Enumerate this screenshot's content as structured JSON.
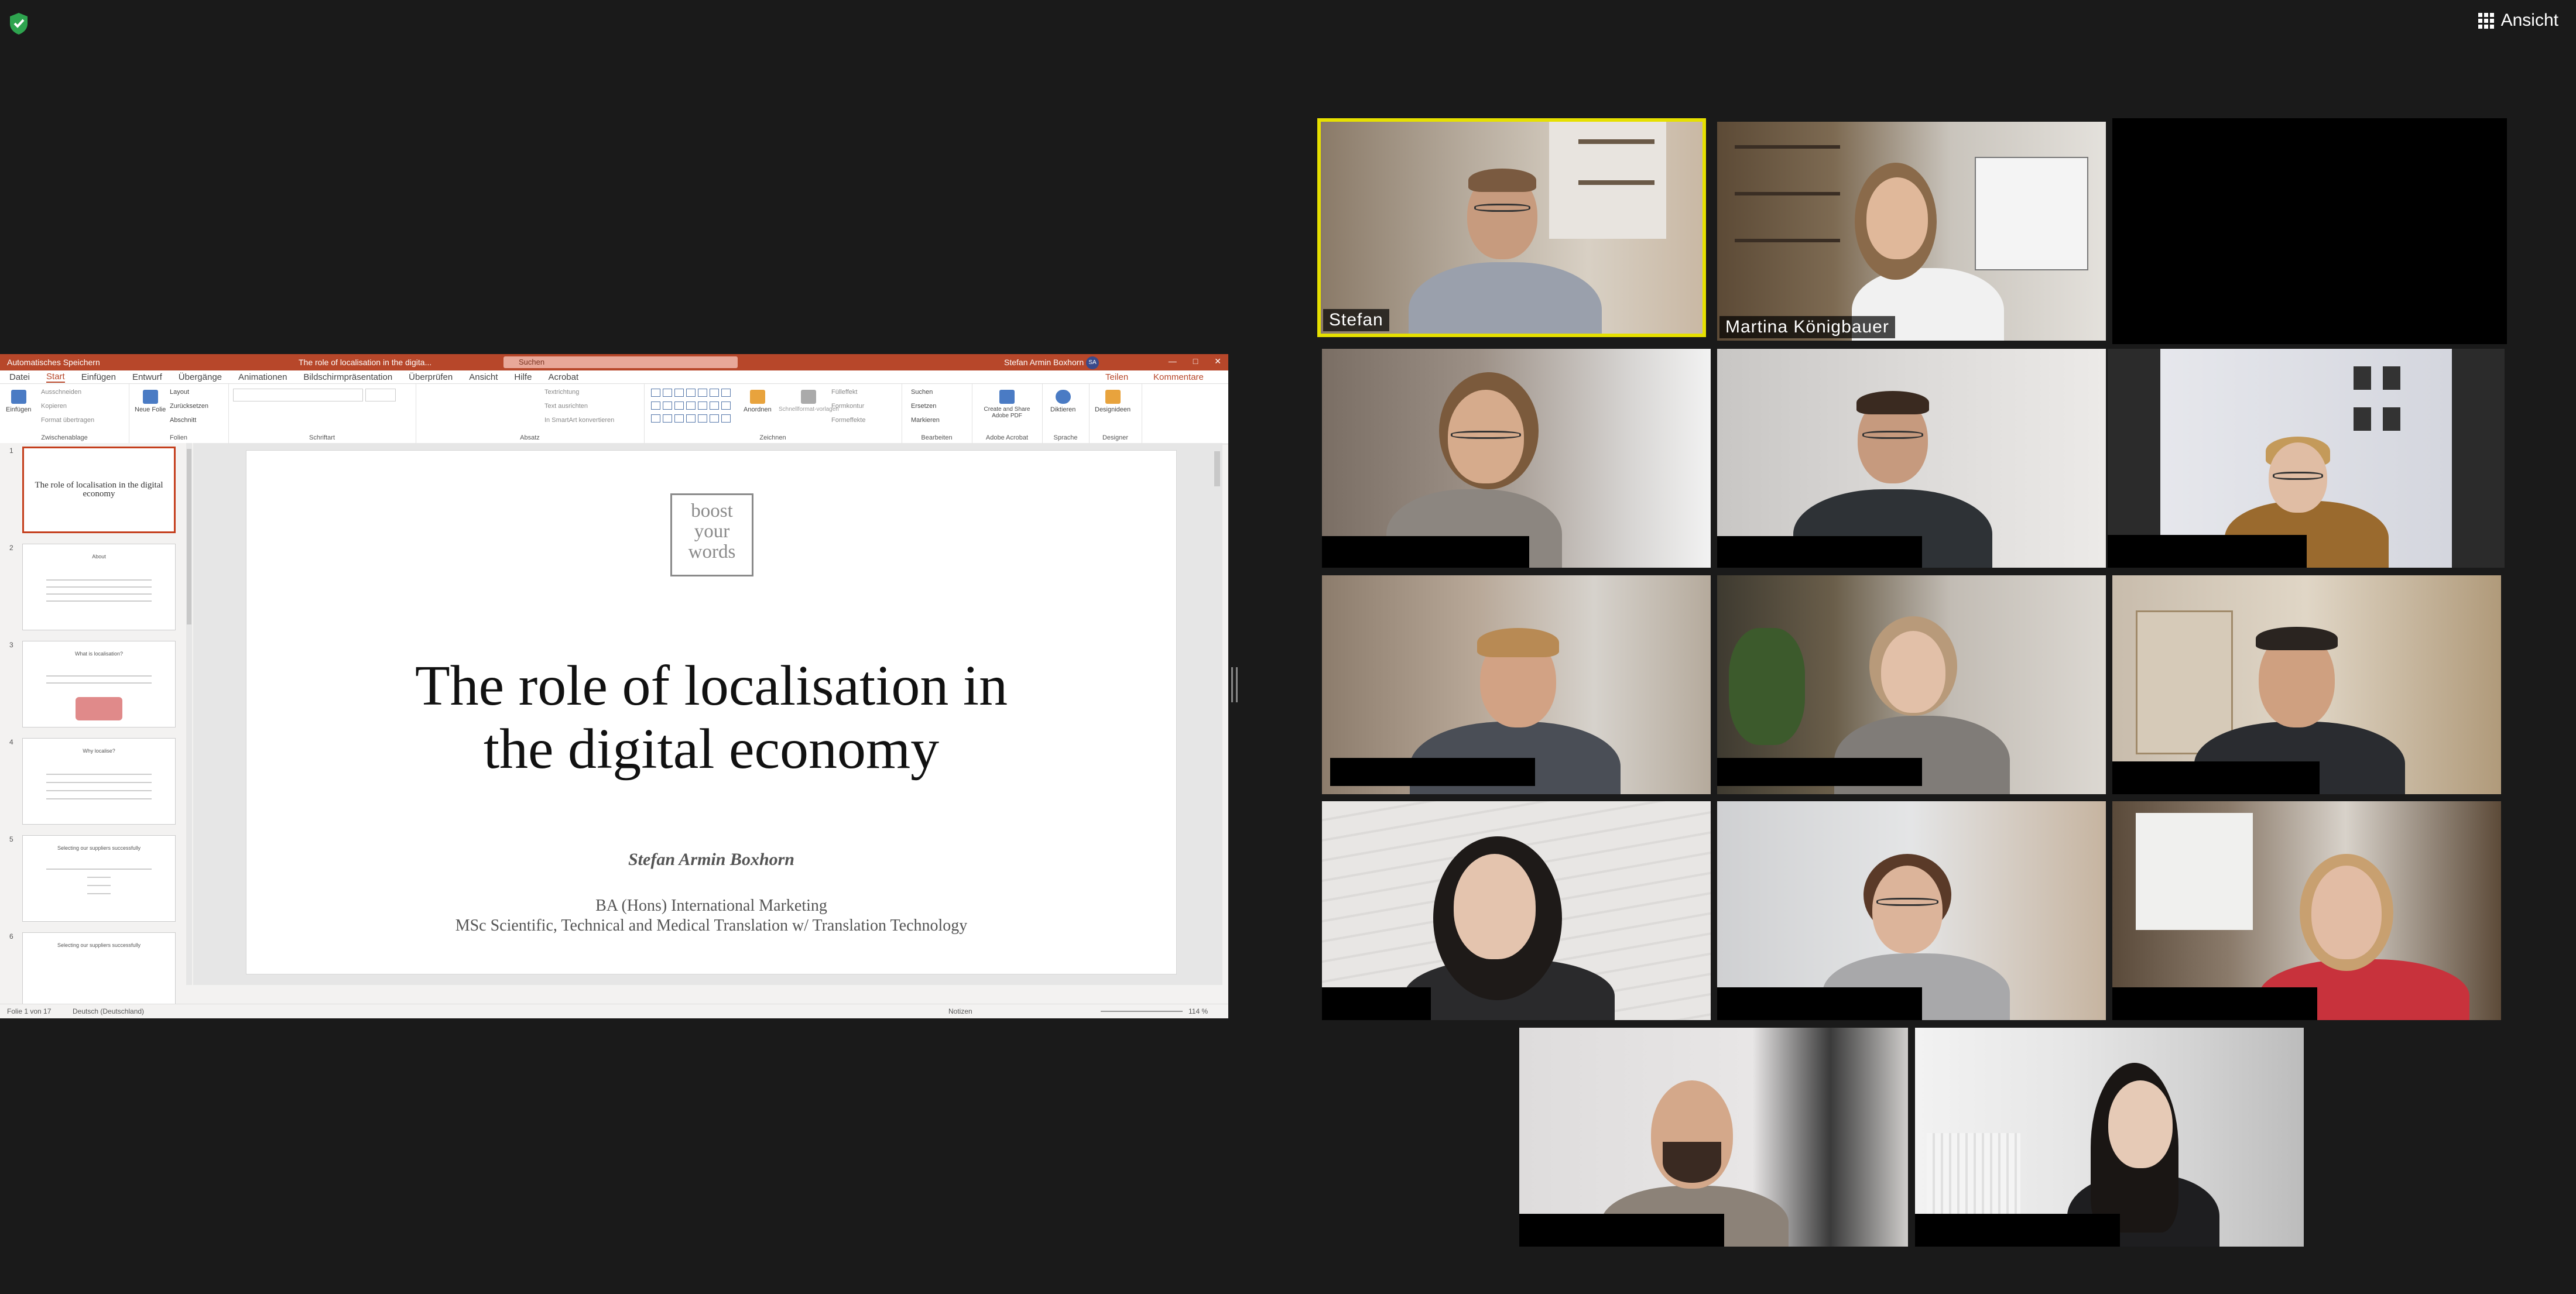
{
  "zoom": {
    "view_button": "Ansicht",
    "security_icon": "shield-check-icon",
    "participants": [
      {
        "name": "Stefan",
        "active_speaker": true
      },
      {
        "name": "Martina Königbauer",
        "active_speaker": false
      }
    ]
  },
  "powerpoint": {
    "titlebar": {
      "autosave": "Automatisches Speichern",
      "document": "The role of localisation in the digita... ",
      "search_placeholder": "Suchen",
      "user": "Stefan Armin Boxhorn",
      "user_initials": "SA"
    },
    "tabs": [
      "Datei",
      "Start",
      "Einfügen",
      "Entwurf",
      "Übergänge",
      "Animationen",
      "Bildschirmpräsentation",
      "Überprüfen",
      "Ansicht",
      "Hilfe",
      "Acrobat"
    ],
    "active_tab": "Start",
    "share_label": "Teilen",
    "comments_label": "Kommentare",
    "ribbon": {
      "clipboard": {
        "paste": "Einfügen",
        "cut": "Ausschneiden",
        "copy": "Kopieren",
        "format_painter": "Format übertragen",
        "label": "Zwischenablage"
      },
      "slides": {
        "new_slide": "Neue Folie",
        "layout": "Layout",
        "reset": "Zurücksetzen",
        "section": "Abschnitt",
        "label": "Folien"
      },
      "font": {
        "label": "Schriftart"
      },
      "paragraph": {
        "text_direction": "Textrichtung",
        "align_text": "Text ausrichten",
        "smartart": "In SmartArt konvertieren",
        "label": "Absatz"
      },
      "drawing": {
        "arrange": "Anordnen",
        "quick_styles": "Schnellformat-vorlagen",
        "fill": "Fülleffekt",
        "outline": "Formkontur",
        "effects": "Formeffekte",
        "label": "Zeichnen"
      },
      "editing": {
        "find": "Suchen",
        "replace": "Ersetzen",
        "select": "Markieren",
        "label": "Bearbeiten"
      },
      "acrobat": {
        "create_share": "Create and Share Adobe PDF",
        "label": "Adobe Acrobat"
      },
      "voice": {
        "dictate": "Diktieren",
        "label": "Sprache"
      },
      "designer": {
        "ideas": "Designideen",
        "label": "Designer"
      }
    },
    "thumbnails": [
      {
        "num": "1",
        "title": "The role of localisation in the digital economy",
        "selected": true
      },
      {
        "num": "2",
        "title": "About",
        "selected": false
      },
      {
        "num": "3",
        "title": "What is localisation?",
        "selected": false
      },
      {
        "num": "4",
        "title": "Why localise?",
        "selected": false
      },
      {
        "num": "5",
        "title": "Selecting our suppliers successfully",
        "selected": false
      },
      {
        "num": "6",
        "title": "Selecting our suppliers successfully",
        "selected": false
      }
    ],
    "slide": {
      "logo_lines": [
        "boost",
        "your",
        "words"
      ],
      "title_line1": "The role of localisation in",
      "title_line2": "the digital economy",
      "author": "Stefan Armin Boxhorn",
      "degree1": "BA (Hons) International Marketing",
      "degree2": "MSc Scientific, Technical and Medical Translation w/ Translation Technology"
    },
    "status": {
      "slide_counter": "Folie 1 von 17",
      "language": "Deutsch (Deutschland)",
      "notes": "Notizen",
      "zoom": "114 %"
    }
  }
}
